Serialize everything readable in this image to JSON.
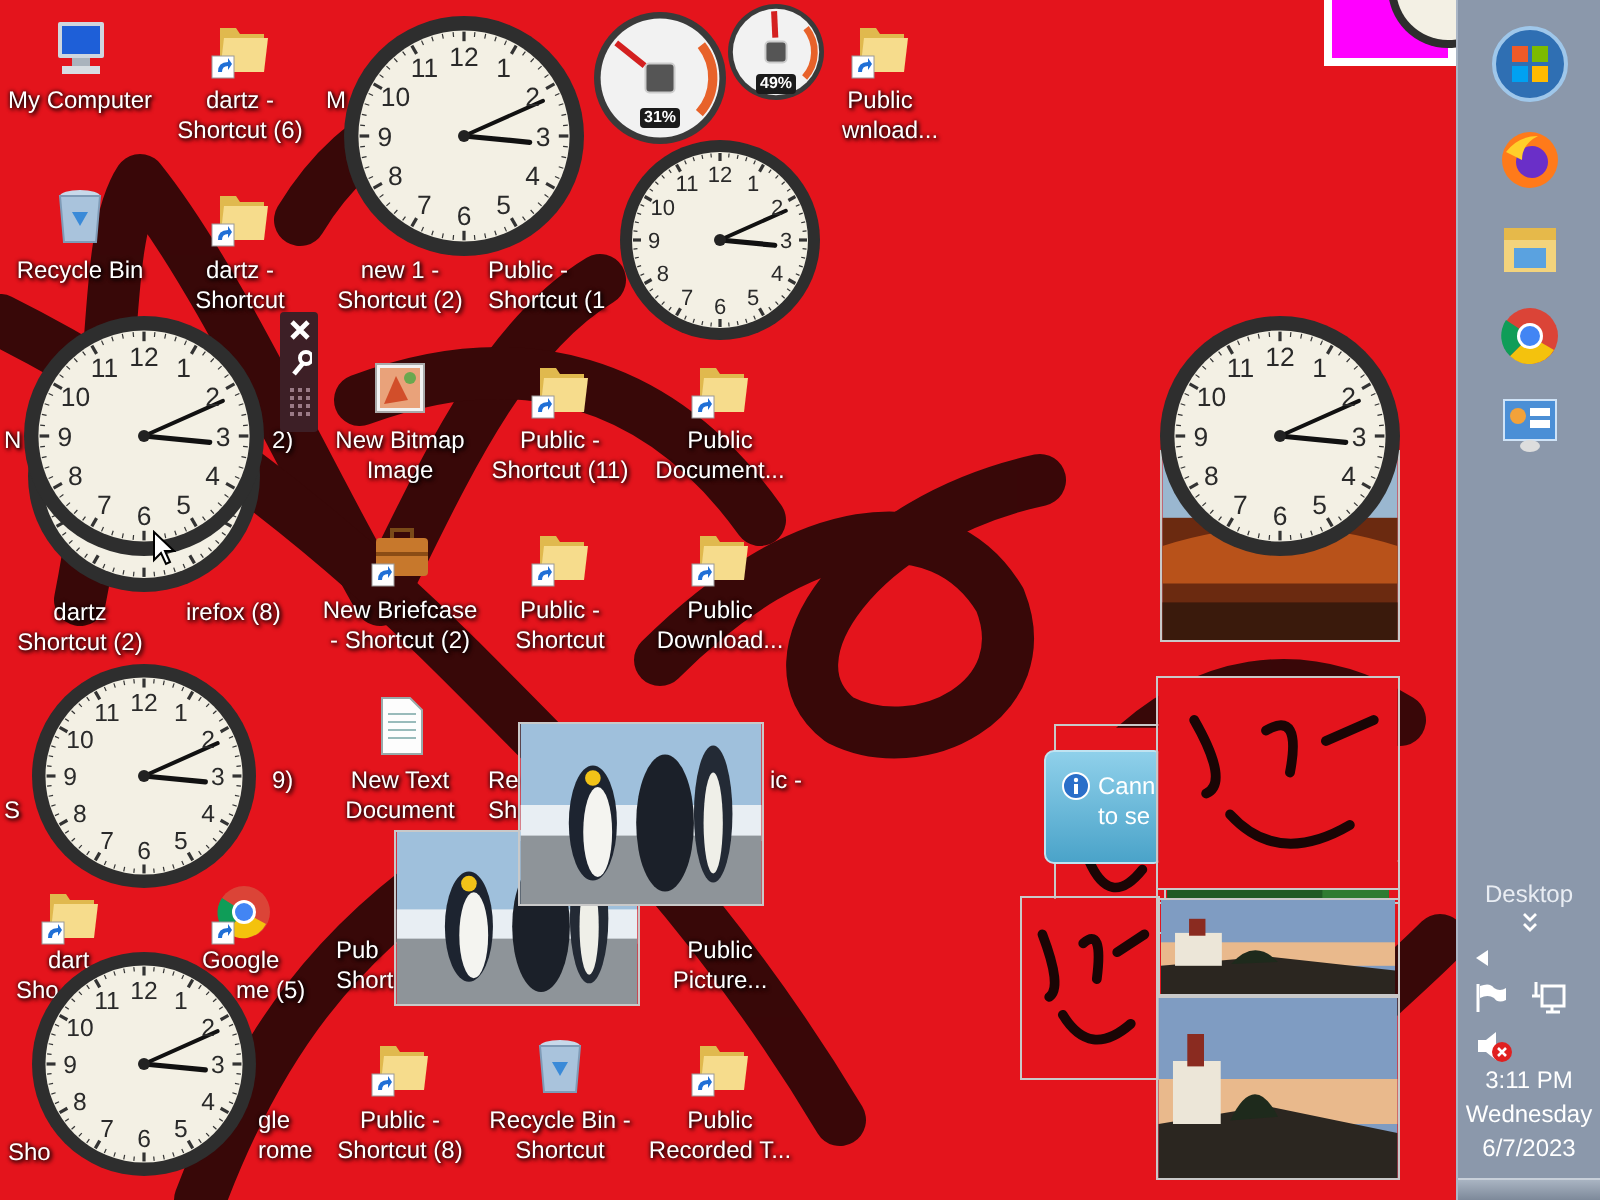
{
  "desktop_icons": [
    {
      "kind": "computer",
      "lines": [
        "My Computer"
      ]
    },
    {
      "kind": "folder",
      "lines": [
        "dartz -",
        "Shortcut (6)"
      ]
    },
    {
      "kind": "text",
      "lines": [
        "M"
      ]
    },
    {
      "kind": "folder",
      "lines": [
        "Public"
      ]
    },
    {
      "kind": "text",
      "lines": [
        "wnload..."
      ]
    },
    {
      "kind": "recycle_bin",
      "lines": [
        "Recycle Bin"
      ]
    },
    {
      "kind": "folder",
      "lines": [
        "dartz -",
        "Shortcut"
      ]
    },
    {
      "kind": "text",
      "lines": [
        "new 1 -",
        "Shortcut (2)"
      ]
    },
    {
      "kind": "text",
      "lines": [
        "Public -",
        "Shortcut (1"
      ]
    },
    {
      "kind": "text",
      "lines": [
        "N"
      ]
    },
    {
      "kind": "text",
      "lines": [
        "2)"
      ]
    },
    {
      "kind": "bitmap",
      "lines": [
        "New Bitmap",
        "Image"
      ]
    },
    {
      "kind": "folder",
      "lines": [
        "Public -",
        "Shortcut (11)"
      ]
    },
    {
      "kind": "folder",
      "lines": [
        "Public",
        "Document..."
      ]
    },
    {
      "kind": "text",
      "lines": [
        "dartz",
        "Shortcut (2)"
      ]
    },
    {
      "kind": "text",
      "lines": [
        "irefox (8)"
      ]
    },
    {
      "kind": "briefcase",
      "lines": [
        "New Briefcase",
        "- Shortcut (2)"
      ]
    },
    {
      "kind": "folder",
      "lines": [
        "Public -",
        "Shortcut"
      ]
    },
    {
      "kind": "folder",
      "lines": [
        "Public",
        "Download..."
      ]
    },
    {
      "kind": "text",
      "lines": [
        "9)"
      ]
    },
    {
      "kind": "text_document",
      "lines": [
        "New Text",
        "Document"
      ]
    },
    {
      "kind": "text",
      "lines": [
        "Re",
        "Sh"
      ]
    },
    {
      "kind": "text",
      "lines": [
        "ic -"
      ]
    },
    {
      "kind": "text",
      "lines": [
        "S"
      ]
    },
    {
      "kind": "folder",
      "lines": [
        "dart"
      ]
    },
    {
      "kind": "browser",
      "lines": [
        "Google"
      ]
    },
    {
      "kind": "text",
      "lines": [
        "Sho"
      ]
    },
    {
      "kind": "text",
      "lines": [
        "me (5)"
      ]
    },
    {
      "kind": "text",
      "lines": [
        "Pub",
        "Short"
      ]
    },
    {
      "kind": "text",
      "lines": [
        "Public",
        "Picture..."
      ]
    },
    {
      "kind": "text",
      "lines": [
        "Sho"
      ]
    },
    {
      "kind": "text",
      "lines": [
        "gle",
        "rome"
      ]
    },
    {
      "kind": "folder",
      "lines": [
        "Public -",
        "Shortcut (8)"
      ]
    },
    {
      "kind": "recycle_bin",
      "lines": [
        "Recycle Bin -",
        "Shortcut"
      ]
    },
    {
      "kind": "folder",
      "lines": [
        "Public",
        "Recorded T..."
      ]
    }
  ],
  "clock_gadgets": [
    {
      "numerals": [
        "11",
        "12",
        "1",
        "10",
        "2",
        "9",
        "3",
        "8",
        "4",
        "7",
        "5",
        "6"
      ]
    },
    {
      "numerals": [
        "11",
        "12",
        "1",
        "10",
        "2",
        "9",
        "3",
        "8",
        "4",
        "7",
        "5",
        "6"
      ]
    },
    {
      "numerals": [
        "11",
        "12",
        "1",
        "10",
        "2",
        "9",
        "3",
        "8",
        "4",
        "7",
        "5",
        "6"
      ]
    },
    {
      "numerals": [
        "11",
        "12",
        "1",
        "10",
        "2",
        "9",
        "3",
        "8",
        "4",
        "7",
        "5",
        "6"
      ]
    },
    {
      "numerals": [
        "11",
        "12",
        "1",
        "10",
        "2",
        "9",
        "3",
        "8",
        "4",
        "7",
        "5",
        "6"
      ]
    },
    {
      "numerals": [
        "11",
        "12",
        "1",
        "10",
        "2",
        "9",
        "3",
        "8",
        "4",
        "7",
        "5",
        "6"
      ]
    }
  ],
  "cpu_meter": {
    "cpu": {
      "reading": "31%",
      "level": 0.31
    },
    "memory": {
      "reading": "49%",
      "level": 0.49
    }
  },
  "notification": {
    "lines": [
      "Cann",
      "to se"
    ]
  },
  "taskbar": {
    "desktop_toolbar": "Desktop",
    "volume_muted": true,
    "time": "3:11 PM",
    "day": "Wednesday",
    "date": "6/7/2023"
  }
}
